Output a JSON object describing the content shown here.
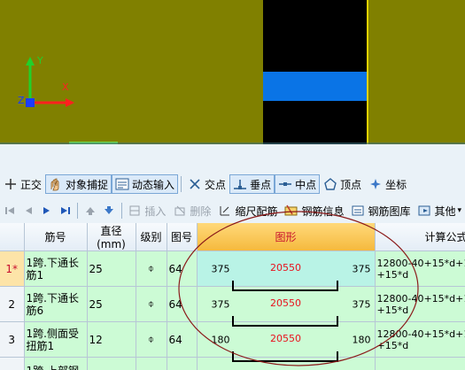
{
  "viewport": {
    "axis_y": "Y",
    "axis_x": "X",
    "axis_z": "Z",
    "colors": {
      "background": "#808000",
      "black_block": "#000000",
      "blue_band": "#0a74e6",
      "yellow_line": "#e6d200"
    }
  },
  "snap_toolbar": {
    "items": [
      {
        "label": "正交",
        "icon": "orthogonal-icon",
        "active": false
      },
      {
        "label": "对象捕捉",
        "icon": "object-snap-icon",
        "active": true
      },
      {
        "label": "动态输入",
        "icon": "dynamic-input-icon",
        "active": true
      },
      {
        "label": "交点",
        "icon": "intersection-icon",
        "active": false
      },
      {
        "label": "垂点",
        "icon": "perpendicular-icon",
        "active": true
      },
      {
        "label": "中点",
        "icon": "midpoint-icon",
        "active": true
      },
      {
        "label": "顶点",
        "icon": "vertex-icon",
        "active": false
      },
      {
        "label": "坐标",
        "icon": "coordinate-icon",
        "active": false
      }
    ]
  },
  "tool_toolbar": {
    "insert": "插入",
    "delete": "删除",
    "scale_rebar": "缩尺配筋",
    "rebar_info": "钢筋信息",
    "rebar_library": "钢筋图库",
    "other": "其他"
  },
  "table": {
    "headers": {
      "bar_no": "筋号",
      "diameter": "直径(mm)",
      "grade": "级别",
      "figure_no": "图号",
      "shape": "图形",
      "formula": "计算公式"
    },
    "rows": [
      {
        "row_no": "1*",
        "selected": true,
        "bar_no": "1跨.下通长筋1",
        "diameter": "25",
        "grade": "⌽",
        "figure_no": "64",
        "shape_left": "375",
        "shape_mid": "20550",
        "shape_right": "375",
        "formula": "12800-40+15*d+143\n+15*d"
      },
      {
        "row_no": "2",
        "selected": false,
        "bar_no": "1跨.下通长筋6",
        "diameter": "25",
        "grade": "⌽",
        "figure_no": "64",
        "shape_left": "375",
        "shape_mid": "20550",
        "shape_right": "375",
        "formula": "12800-40+15*d+143\n+15*d"
      },
      {
        "row_no": "3",
        "selected": false,
        "bar_no": "1跨.侧面受扭筋1",
        "diameter": "12",
        "grade": "⌽",
        "figure_no": "64",
        "shape_left": "180",
        "shape_mid": "20550",
        "shape_right": "180",
        "formula": "12800-40+15*d+143\n+15*d"
      },
      {
        "row_no": "",
        "selected": false,
        "bar_no": "1跨.上部钢",
        "diameter": "",
        "grade": "",
        "figure_no": "",
        "shape_left": "",
        "shape_mid": "",
        "shape_right": "",
        "formula": ""
      }
    ]
  }
}
